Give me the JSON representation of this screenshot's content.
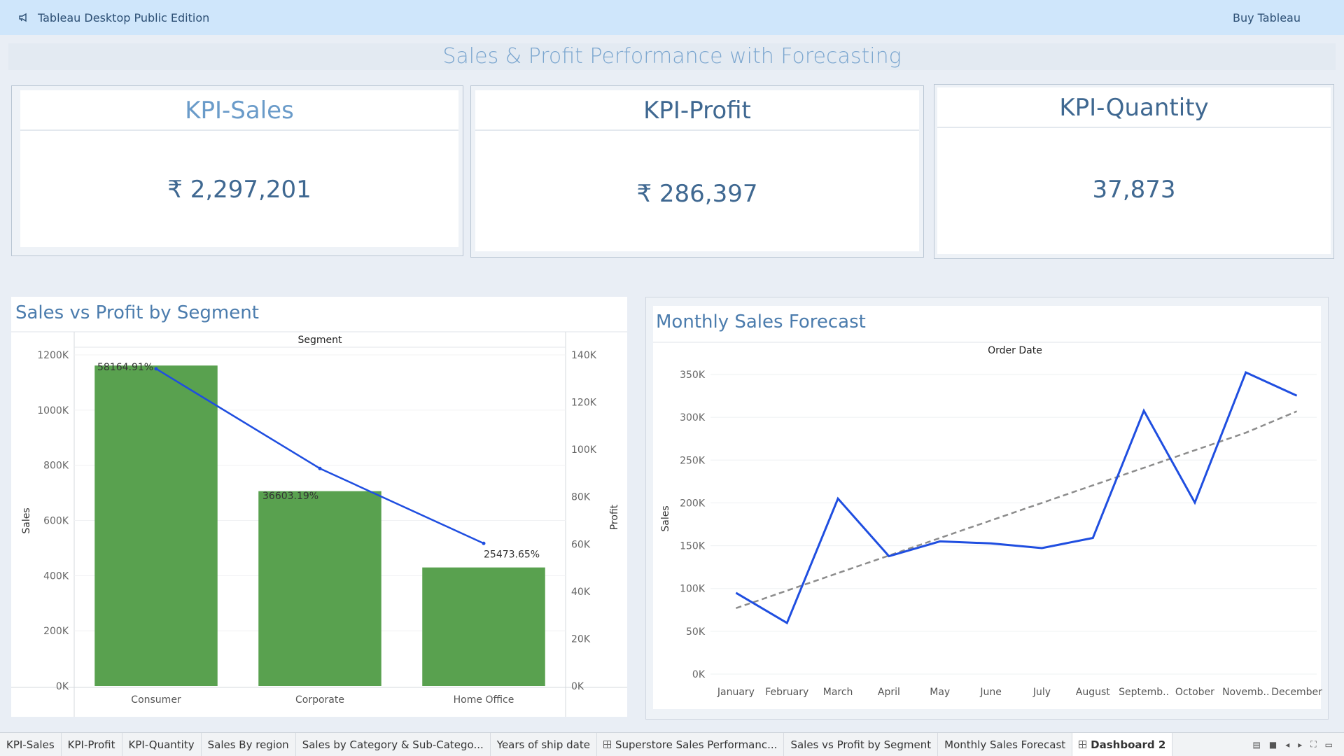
{
  "app": {
    "title": "Tableau Desktop Public Edition",
    "buy_label": "Buy Tableau"
  },
  "dashboard": {
    "title": "Sales & Profit Performance with Forecasting"
  },
  "kpis": [
    {
      "title": "KPI-Sales",
      "value": "₹ 2,297,201",
      "title_color": "#6a9bc9"
    },
    {
      "title": "KPI-Profit",
      "value": "₹ 286,397",
      "title_color": "#3f6891"
    },
    {
      "title": "KPI-Quantity",
      "value": "37,873",
      "title_color": "#3f6891"
    }
  ],
  "segment_chart": {
    "title": "Sales vs Profit by Segment",
    "header": "Segment",
    "y_left_label": "Sales",
    "y_right_label": "Profit",
    "y_left_ticks": [
      "0K",
      "200K",
      "400K",
      "600K",
      "800K",
      "1000K",
      "1200K"
    ],
    "y_right_ticks": [
      "0K",
      "20K",
      "40K",
      "60K",
      "80K",
      "100K",
      "120K",
      "140K"
    ]
  },
  "forecast_chart": {
    "title": "Monthly Sales Forecast",
    "header": "Order Date",
    "y_label": "Sales",
    "y_ticks": [
      "0K",
      "50K",
      "100K",
      "150K",
      "200K",
      "250K",
      "300K",
      "350K"
    ],
    "x_labels": [
      "January",
      "February",
      "March",
      "April",
      "May",
      "June",
      "July",
      "August",
      "Septemb..",
      "October",
      "Novemb..",
      "December"
    ]
  },
  "chart_data": [
    {
      "type": "bar",
      "title": "Sales vs Profit by Segment",
      "xlabel": "Segment",
      "ylabel": "Sales",
      "y2label": "Profit",
      "categories": [
        "Consumer",
        "Corporate",
        "Home Office"
      ],
      "series": [
        {
          "name": "Sales",
          "type": "bar",
          "axis": "left",
          "values": [
            1161401,
            706146,
            429653
          ],
          "color": "#59a14f"
        },
        {
          "name": "Profit",
          "type": "line",
          "axis": "right",
          "values": [
            134119,
            91979,
            60299
          ],
          "color": "#1f4ee0"
        }
      ],
      "data_labels": [
        "58164.91%",
        "36603.19%",
        "25473.65%"
      ],
      "ylim": [
        0,
        1200000
      ],
      "y2lim": [
        0,
        140000
      ],
      "grid": true
    },
    {
      "type": "line",
      "title": "Monthly Sales Forecast",
      "xlabel": "Order Date",
      "ylabel": "Sales",
      "categories": [
        "January",
        "February",
        "March",
        "April",
        "May",
        "June",
        "July",
        "August",
        "September",
        "October",
        "November",
        "December"
      ],
      "series": [
        {
          "name": "Sales",
          "values": [
            94925,
            59751,
            205005,
            137762,
            155029,
            152719,
            147238,
            159044,
            307650,
            200323,
            352461,
            325294
          ],
          "color": "#1f4ee0"
        },
        {
          "name": "Trend",
          "style": "dashed",
          "values": [
            77000,
            97500,
            118000,
            138500,
            159000,
            179500,
            200000,
            220500,
            241000,
            261500,
            282000,
            307000
          ],
          "color": "#8c8c8c"
        }
      ],
      "ylim": [
        0,
        350000
      ],
      "grid": true
    }
  ],
  "tabs": [
    {
      "label": "KPI-Sales",
      "icon": "",
      "active": false
    },
    {
      "label": "KPI-Profit",
      "icon": "",
      "active": false
    },
    {
      "label": "KPI-Quantity",
      "icon": "",
      "active": false
    },
    {
      "label": "Sales By region",
      "icon": "",
      "active": false
    },
    {
      "label": "Sales by Category & Sub-Catego...",
      "icon": "",
      "active": false
    },
    {
      "label": "Years of ship date",
      "icon": "",
      "active": false
    },
    {
      "label": "Superstore Sales Performanc...",
      "icon": "dashboard-icon",
      "active": false
    },
    {
      "label": "Sales vs Profit by Segment",
      "icon": "",
      "active": false
    },
    {
      "label": "Monthly Sales Forecast",
      "icon": "",
      "active": false
    },
    {
      "label": "Dashboard 2",
      "icon": "dashboard-icon",
      "active": true
    }
  ]
}
